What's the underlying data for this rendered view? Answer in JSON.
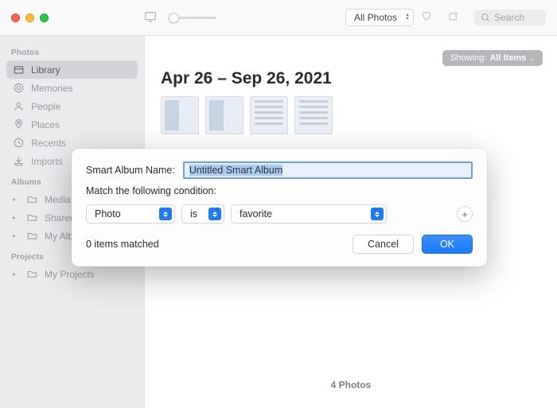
{
  "sidebar": {
    "sections": {
      "photos": {
        "header": "Photos",
        "items": [
          "Library",
          "Memories",
          "People",
          "Places",
          "Recents",
          "Imports"
        ]
      },
      "albums": {
        "header": "Albums",
        "items": [
          "Media Types",
          "Shared Albums",
          "My Albums"
        ]
      },
      "projects": {
        "header": "Projects",
        "items": [
          "My Projects"
        ]
      }
    }
  },
  "toolbar": {
    "filter_label": "All Photos",
    "search_placeholder": "Search"
  },
  "content": {
    "showing_prefix": "Showing:",
    "showing_value": "All Items",
    "date_range": "Apr 26 – Sep 26, 2021",
    "footer_count": "4 Photos"
  },
  "modal": {
    "name_label": "Smart Album Name:",
    "name_value": "Untitled Smart Album",
    "match_text": "Match the following condition:",
    "select_photo": "Photo",
    "select_is": "is",
    "select_fav": "favorite",
    "matched_text": "0 items matched",
    "cancel": "Cancel",
    "ok": "OK"
  }
}
